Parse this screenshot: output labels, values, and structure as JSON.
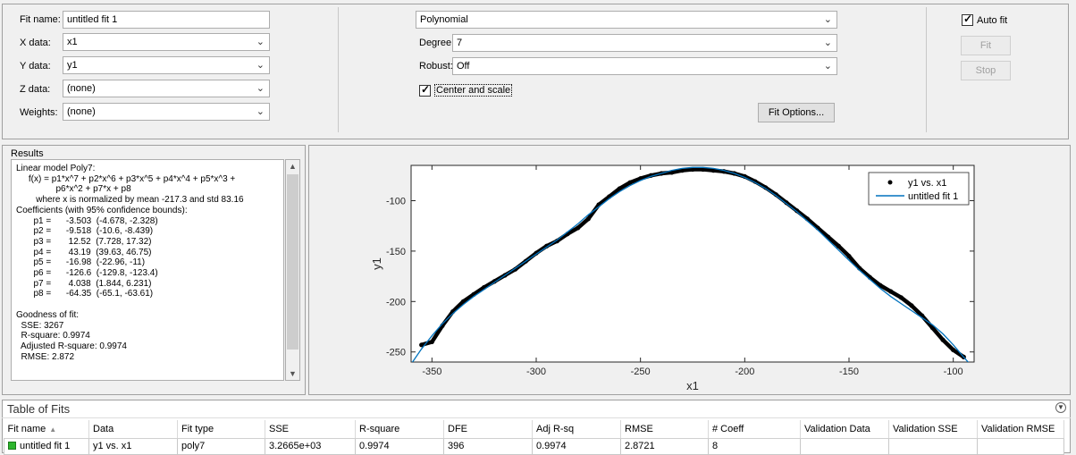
{
  "fit_settings": {
    "fit_name_label": "Fit name:",
    "fit_name_value": "untitled fit 1",
    "x_data_label": "X data:",
    "x_data_value": "x1",
    "y_data_label": "Y data:",
    "y_data_value": "y1",
    "z_data_label": "Z data:",
    "z_data_value": "(none)",
    "weights_label": "Weights:",
    "weights_value": "(none)"
  },
  "fit_type": {
    "type_value": "Polynomial",
    "degree_label": "Degree:",
    "degree_value": "7",
    "robust_label": "Robust:",
    "robust_value": "Off",
    "center_scale_label": "Center and scale",
    "center_scale_checked": true,
    "fit_options_label": "Fit Options..."
  },
  "fit_controls": {
    "auto_fit_label": "Auto fit",
    "auto_fit_checked": true,
    "fit_label": "Fit",
    "stop_label": "Stop"
  },
  "results": {
    "title": "Results",
    "lines": [
      "Linear model Poly7:",
      "     f(x) = p1*x^7 + p2*x^6 + p3*x^5 + p4*x^4 + p5*x^3 +",
      "                p6*x^2 + p7*x + p8",
      "        where x is normalized by mean -217.3 and std 83.16",
      "Coefficients (with 95% confidence bounds):",
      "       p1 =      -3.503  (-4.678, -2.328)",
      "       p2 =      -9.518  (-10.6, -8.439)",
      "       p3 =       12.52  (7.728, 17.32)",
      "       p4 =       43.19  (39.63, 46.75)",
      "       p5 =      -16.98  (-22.96, -11)",
      "       p6 =      -126.6  (-129.8, -123.4)",
      "       p7 =       4.038  (1.844, 6.231)",
      "       p8 =      -64.35  (-65.1, -63.61)",
      "",
      "Goodness of fit:",
      "  SSE: 3267",
      "  R-square: 0.9974",
      "  Adjusted R-square: 0.9974",
      "  RMSE: 2.872"
    ]
  },
  "chart_data": {
    "type": "scatter",
    "xlabel": "x1",
    "ylabel": "y1",
    "xlim": [
      -360,
      -90
    ],
    "ylim": [
      -260,
      -65
    ],
    "xticks": [
      -350,
      -300,
      -250,
      -200,
      -150,
      -100
    ],
    "yticks": [
      -100,
      -150,
      -200,
      -250
    ],
    "legend_position": "top-right",
    "grid": false,
    "series": [
      {
        "name": "y1 vs. x1",
        "kind": "points",
        "color": "#000000",
        "x": [
          -355,
          -350,
          -345,
          -340,
          -335,
          -330,
          -325,
          -320,
          -315,
          -310,
          -305,
          -300,
          -295,
          -290,
          -285,
          -280,
          -275,
          -270,
          -265,
          -260,
          -255,
          -250,
          -245,
          -240,
          -235,
          -230,
          -225,
          -220,
          -215,
          -210,
          -205,
          -200,
          -195,
          -190,
          -185,
          -180,
          -175,
          -170,
          -165,
          -160,
          -155,
          -150,
          -145,
          -140,
          -135,
          -130,
          -125,
          -120,
          -115,
          -110,
          -105,
          -100,
          -95
        ],
        "y": [
          -243,
          -240,
          -224,
          -210,
          -200,
          -193,
          -186,
          -180,
          -174,
          -168,
          -160,
          -152,
          -145,
          -140,
          -133,
          -127,
          -118,
          -104,
          -96,
          -88,
          -82,
          -78,
          -75,
          -73,
          -72,
          -70,
          -69,
          -69,
          -70,
          -71,
          -73,
          -76,
          -81,
          -87,
          -94,
          -102,
          -110,
          -118,
          -127,
          -136,
          -145,
          -155,
          -167,
          -176,
          -184,
          -190,
          -196,
          -204,
          -214,
          -226,
          -238,
          -248,
          -255
        ]
      },
      {
        "name": "untitled fit 1",
        "kind": "line",
        "color": "#0072bd",
        "x": [
          -360,
          -355,
          -350,
          -345,
          -340,
          -335,
          -330,
          -325,
          -320,
          -315,
          -310,
          -305,
          -300,
          -295,
          -290,
          -285,
          -280,
          -275,
          -270,
          -265,
          -260,
          -255,
          -250,
          -245,
          -240,
          -235,
          -230,
          -225,
          -220,
          -215,
          -210,
          -205,
          -200,
          -195,
          -190,
          -185,
          -180,
          -175,
          -170,
          -165,
          -160,
          -155,
          -150,
          -145,
          -140,
          -135,
          -130,
          -125,
          -120,
          -115,
          -110,
          -105,
          -100,
          -95,
          -92
        ],
        "y": [
          -262,
          -247,
          -234,
          -222,
          -212,
          -203,
          -195,
          -188,
          -181,
          -174,
          -167,
          -160,
          -153,
          -146,
          -139,
          -131,
          -123,
          -114,
          -106,
          -98,
          -91,
          -85,
          -80,
          -76,
          -73,
          -70,
          -68,
          -67,
          -67,
          -68,
          -70,
          -73,
          -77,
          -82,
          -88,
          -95,
          -103,
          -111,
          -120,
          -129,
          -139,
          -149,
          -159,
          -169,
          -178,
          -187,
          -195,
          -202,
          -209,
          -216,
          -223,
          -232,
          -243,
          -255,
          -262
        ]
      }
    ]
  },
  "table_of_fits": {
    "title": "Table of Fits",
    "columns": [
      "Fit name",
      "Data",
      "Fit type",
      "SSE",
      "R-square",
      "DFE",
      "Adj R-sq",
      "RMSE",
      "# Coeff",
      "Validation Data",
      "Validation SSE",
      "Validation RMSE"
    ],
    "rows": [
      [
        "untitled fit 1",
        "y1 vs. x1",
        "poly7",
        "3.2665e+03",
        "0.9974",
        "396",
        "0.9974",
        "2.8721",
        "8",
        "",
        "",
        ""
      ]
    ],
    "status_color": "#2db52d"
  }
}
